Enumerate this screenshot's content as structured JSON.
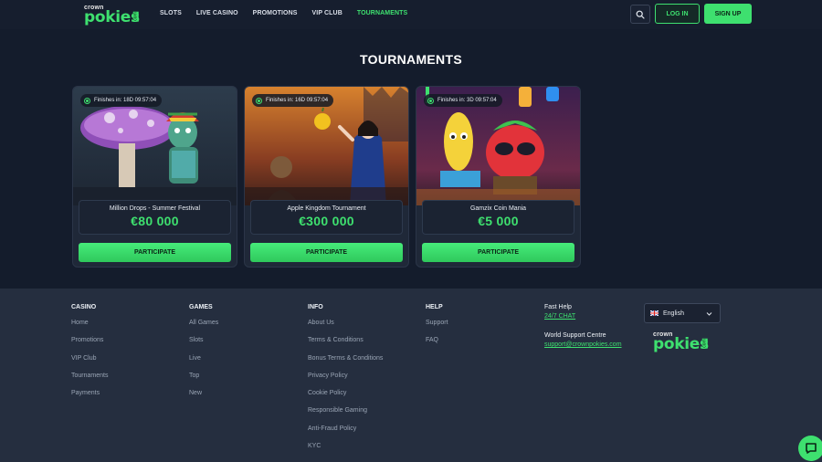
{
  "header": {
    "logo": {
      "small": "crown",
      "big": "pokies",
      "suffix": "com"
    },
    "nav": [
      "SLOTS",
      "LIVE CASINO",
      "PROMOTIONS",
      "VIP CLUB",
      "TOURNAMENTS"
    ],
    "active_nav": "TOURNAMENTS",
    "login_label": "LOG IN",
    "signup_label": "SIGN UP"
  },
  "page_title": "TOURNAMENTS",
  "tournaments": [
    {
      "timer": "Finishes in: 18D 09:57:04",
      "name": "Million Drops - Summer Festival",
      "prize": "€80 000",
      "button": "PARTICIPATE"
    },
    {
      "timer": "Finishes in: 16D 09:57:04",
      "name": "Apple Kingdom Tournament",
      "prize": "€300 000",
      "button": "PARTICIPATE"
    },
    {
      "timer": "Finishes in: 3D 09:57:04",
      "name": "Gamzix Coin Mania",
      "prize": "€5 000",
      "button": "PARTICIPATE"
    }
  ],
  "footer": {
    "casino": {
      "title": "CASINO",
      "links": [
        "Home",
        "Promotions",
        "VIP Club",
        "Tournaments",
        "Payments"
      ]
    },
    "games": {
      "title": "GAMES",
      "links": [
        "All Games",
        "Slots",
        "Live",
        "Top",
        "New"
      ]
    },
    "info": {
      "title": "INFO",
      "links": [
        "About Us",
        "Terms & Conditions",
        "Bonus Terms & Conditions",
        "Privacy Policy",
        "Cookie Policy",
        "Responsible Gaming",
        "Anti-Fraud Policy",
        "KYC"
      ]
    },
    "help": {
      "title": "HELP",
      "links": [
        "Support",
        "FAQ"
      ]
    },
    "fast_help": {
      "title": "Fast Help",
      "link": "24/7 CHAT"
    },
    "world_support": {
      "title": "World Support Centre",
      "link": "support@crownpokies.com"
    },
    "language": "English"
  },
  "colors": {
    "accent": "#3ee06f",
    "background": "#141c2c",
    "footer": "#252e3f"
  }
}
